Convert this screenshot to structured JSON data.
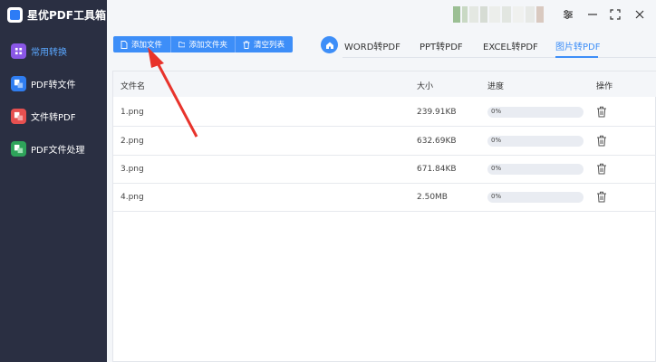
{
  "app": {
    "title": "星优PDF工具箱"
  },
  "sidebar": {
    "items": [
      {
        "label": "常用转换",
        "icon": "common-convert-icon",
        "active": true
      },
      {
        "label": "PDF转文件",
        "icon": "pdf-to-file-icon",
        "active": false
      },
      {
        "label": "文件转PDF",
        "icon": "file-to-pdf-icon",
        "active": false
      },
      {
        "label": "PDF文件处理",
        "icon": "pdf-process-icon",
        "active": false
      }
    ]
  },
  "toolbar": {
    "add_file": "添加文件",
    "add_folder": "添加文件夹",
    "clear_list": "清空列表"
  },
  "tabs": [
    {
      "label": "WORD转PDF",
      "active": false
    },
    {
      "label": "PPT转PDF",
      "active": false
    },
    {
      "label": "EXCEL转PDF",
      "active": false
    },
    {
      "label": "图片转PDF",
      "active": true
    }
  ],
  "table": {
    "headers": {
      "name": "文件名",
      "size": "大小",
      "progress": "进度",
      "action": "操作"
    },
    "rows": [
      {
        "name": "1.png",
        "size": "239.91KB",
        "progress": "0%"
      },
      {
        "name": "2.png",
        "size": "632.69KB",
        "progress": "0%"
      },
      {
        "name": "3.png",
        "size": "671.84KB",
        "progress": "0%"
      },
      {
        "name": "4.png",
        "size": "2.50MB",
        "progress": "0%"
      }
    ]
  },
  "colors": {
    "accent": "#3d8ef8",
    "sidebar_bg": "#2a2f42",
    "annotation_arrow": "#e8332b"
  }
}
